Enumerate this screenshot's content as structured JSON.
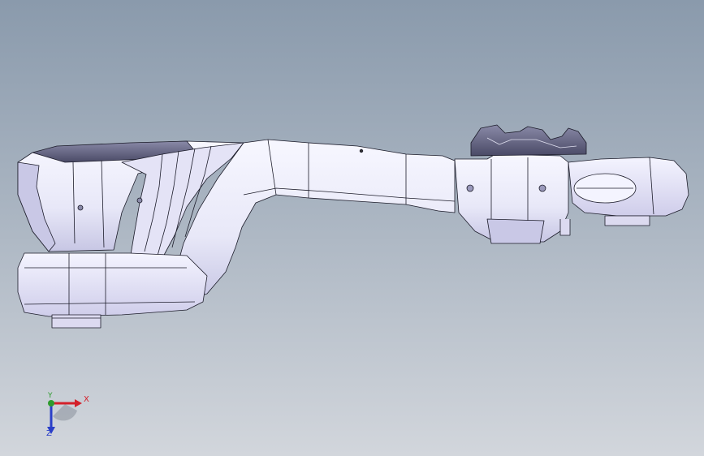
{
  "viewport": {
    "background_top": "#8a9aac",
    "background_bottom": "#d2d6dc",
    "model_fill": "#eeeefb",
    "model_shade": "#c9c8e6",
    "edge_color": "#1c1c2a"
  },
  "model": {
    "icon": "lower-control-arm-model"
  },
  "triad": {
    "x_label": "X",
    "y_label": "Y",
    "z_label": "Z",
    "x_color": "#d4202a",
    "y_color": "#2e9b2e",
    "z_color": "#2a3fc8"
  }
}
